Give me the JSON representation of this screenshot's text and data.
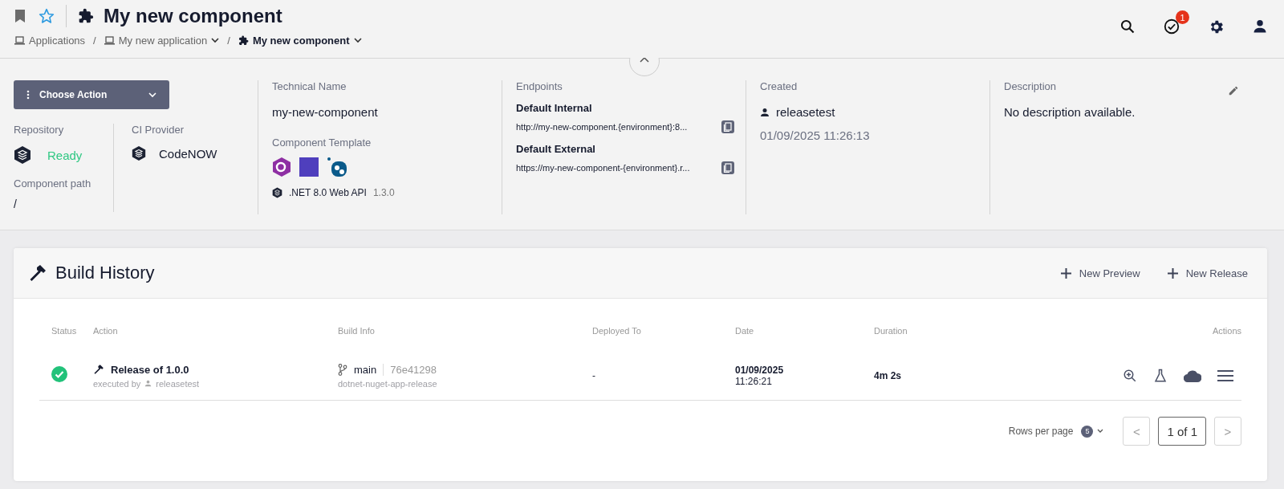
{
  "header": {
    "title": "My new component",
    "notification_count": "1"
  },
  "breadcrumbs": [
    {
      "label": "Applications",
      "kind": "app"
    },
    {
      "separator_before": "/",
      "label": "My new application",
      "kind": "app-dropdown"
    },
    {
      "separator_before": "/",
      "label": "My new component",
      "kind": "current"
    }
  ],
  "info": {
    "action_button": "Choose Action",
    "repository": {
      "label": "Repository",
      "status": "Ready"
    },
    "ci_provider": {
      "label": "CI Provider",
      "value": "CodeNOW"
    },
    "component_path": {
      "label": "Component path",
      "value": "/"
    },
    "technical_name": {
      "label": "Technical Name",
      "value": "my-new-component"
    },
    "component_template": {
      "label": "Component Template",
      "name": ".NET 8.0 Web API",
      "version": "1.3.0"
    },
    "endpoints": {
      "label": "Endpoints",
      "items": [
        {
          "name": "Default Internal",
          "url": "http://my-new-component.{environment}:8..."
        },
        {
          "name": "Default External",
          "url": "https://my-new-component-{environment}.r..."
        }
      ]
    },
    "created": {
      "label": "Created",
      "user": "releasetest",
      "date": "01/09/2025 11:26:13"
    },
    "description": {
      "label": "Description",
      "text": "No description available."
    }
  },
  "build_history": {
    "title": "Build History",
    "actions": [
      "New Preview",
      "New Release"
    ],
    "columns": [
      "Status",
      "Action",
      "Build Info",
      "Deployed To",
      "Date",
      "Duration",
      "Actions"
    ],
    "rows": [
      {
        "color": "#22c27a",
        "action": "Release of 1.0.0",
        "executed_by_label": "executed by",
        "executed_by": "releasetest",
        "branch": "main",
        "commit": "76e41298",
        "pipeline": "dotnet-nuget-app-release",
        "deployed_to": "-",
        "date": "01/09/2025",
        "time": "11:26:21",
        "duration": "4m 2s"
      }
    ],
    "rows_per_page_label": "Rows per page",
    "rows_per_page": "5",
    "page": "1 of 1",
    "prev": "<",
    "next": ">"
  }
}
